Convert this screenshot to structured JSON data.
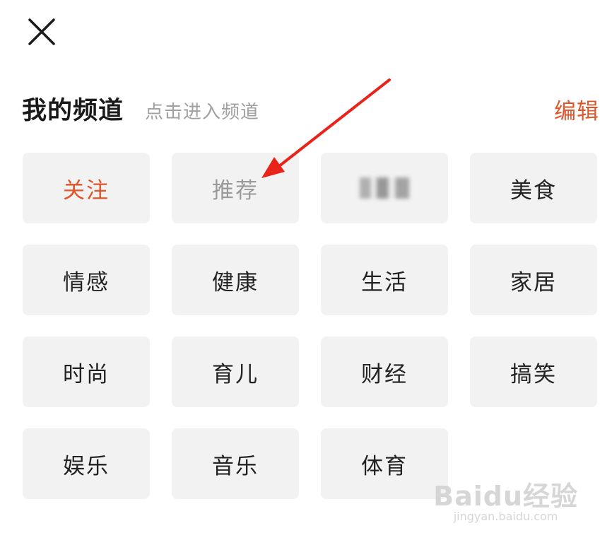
{
  "header": {
    "title": "我的频道",
    "subtitle": "点击进入频道",
    "edit_label": "编辑"
  },
  "channels": [
    {
      "label": "关注",
      "state": "active"
    },
    {
      "label": "推荐",
      "state": "current"
    },
    {
      "label": "",
      "state": "blurred"
    },
    {
      "label": "美食",
      "state": "normal"
    },
    {
      "label": "情感",
      "state": "normal"
    },
    {
      "label": "健康",
      "state": "normal"
    },
    {
      "label": "生活",
      "state": "normal"
    },
    {
      "label": "家居",
      "state": "normal"
    },
    {
      "label": "时尚",
      "state": "normal"
    },
    {
      "label": "育儿",
      "state": "normal"
    },
    {
      "label": "财经",
      "state": "normal"
    },
    {
      "label": "搞笑",
      "state": "normal"
    },
    {
      "label": "娱乐",
      "state": "normal"
    },
    {
      "label": "音乐",
      "state": "normal"
    },
    {
      "label": "体育",
      "state": "normal"
    }
  ],
  "watermark": {
    "logo": "Baidu经验",
    "domain": "jingyan.baidu.com"
  },
  "colors": {
    "accent": "#e0542a",
    "chip_bg": "#f2f2f2",
    "annotation_arrow": "#e8231a"
  },
  "icons": {
    "close": "close-icon",
    "arrow": "annotation-arrow"
  }
}
